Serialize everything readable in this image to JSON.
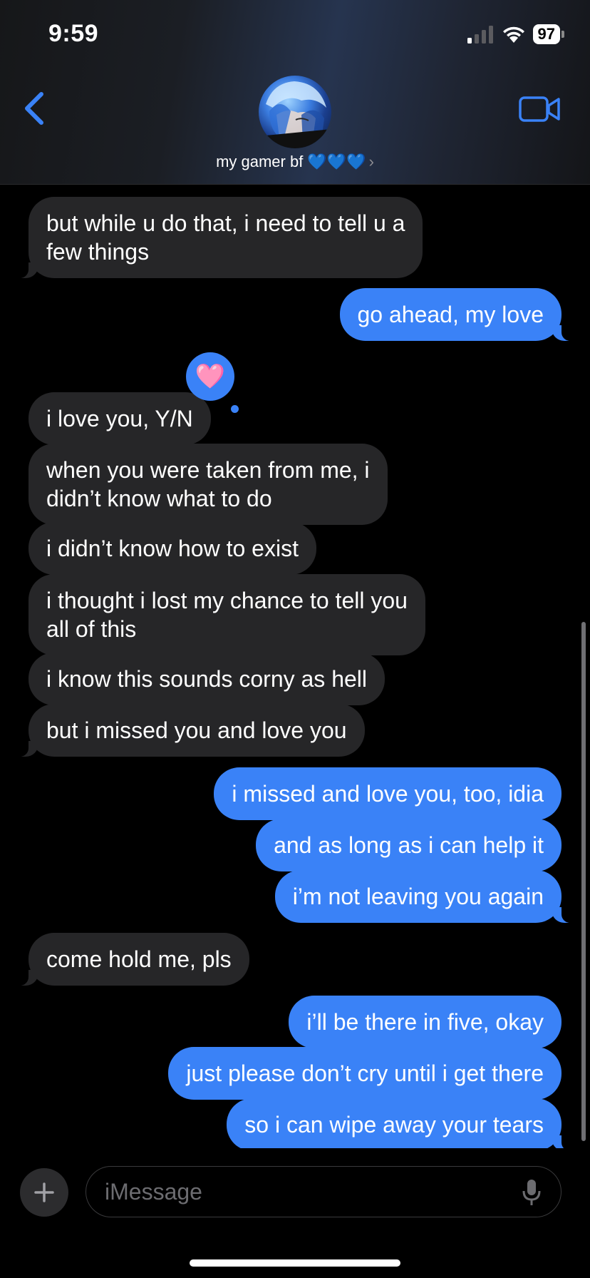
{
  "status_bar": {
    "time": "9:59",
    "battery": "97"
  },
  "header": {
    "contact_name": "my gamer bf 💙💙💙",
    "chevron": "›"
  },
  "messages": [
    {
      "text": "but while u do that, i need to tell u a\nfew things"
    },
    {
      "text": "go ahead, my love"
    },
    {
      "text": "i love you, Y/N"
    },
    {
      "text": "when you were taken from me, i\ndidn’t know what to do"
    },
    {
      "text": "i didn’t know how to exist"
    },
    {
      "text": "i thought i lost my chance to tell you\nall of this"
    },
    {
      "text": "i know this sounds corny as hell"
    },
    {
      "text": "but i missed you and love you"
    },
    {
      "text": "i missed and love you, too, idia"
    },
    {
      "text": "and as long as i can help it"
    },
    {
      "text": "i’m not leaving you again"
    },
    {
      "text": "come hold me, pls"
    },
    {
      "text": "i’ll be there in five, okay"
    },
    {
      "text": "just please don’t cry until i get there"
    },
    {
      "text": "so i can wipe away your tears"
    }
  ],
  "tapback": {
    "emoji": "🩷"
  },
  "composer": {
    "placeholder": "iMessage"
  },
  "colors": {
    "outgoing": "#3a82f7",
    "incoming": "#262628",
    "accent": "#3a82f7"
  },
  "icons": {
    "back": "chevron-left-icon",
    "video": "video-camera-icon",
    "plus": "plus-icon",
    "mic": "microphone-icon"
  }
}
